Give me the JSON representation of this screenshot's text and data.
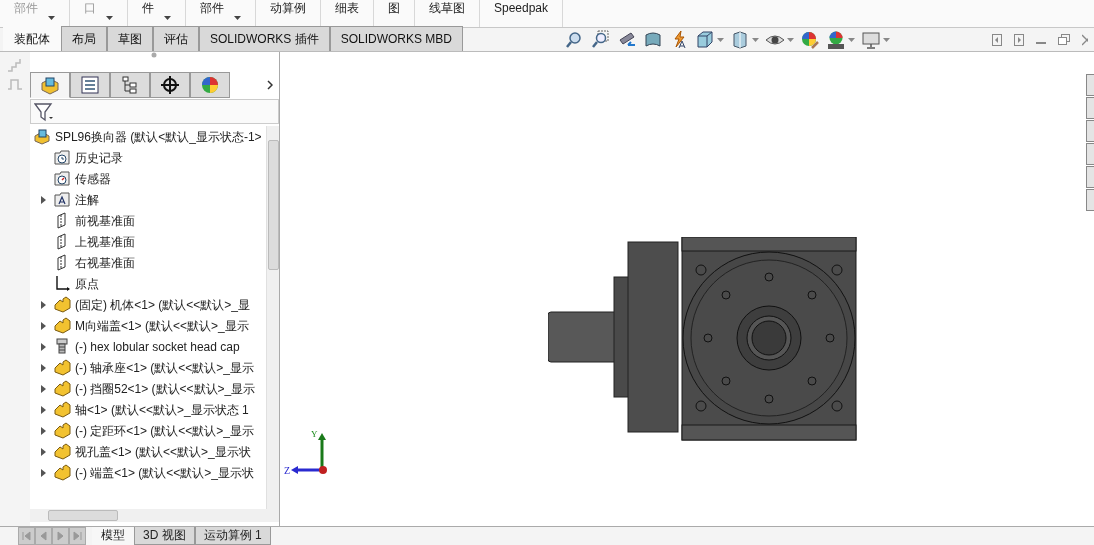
{
  "ribbon": [
    {
      "label": "部件",
      "disabled": true,
      "dropdown": true
    },
    {
      "label": "口",
      "disabled": true,
      "dropdown": true
    },
    {
      "label": "件",
      "disabled": false,
      "dropdown": true
    },
    {
      "label": "部件",
      "disabled": false,
      "dropdown": true
    },
    {
      "label": "动算例",
      "disabled": false,
      "dropdown": false
    },
    {
      "label": "细表",
      "disabled": false,
      "dropdown": false
    },
    {
      "label": "图",
      "disabled": false,
      "dropdown": false
    },
    {
      "label": "线草图",
      "disabled": false,
      "dropdown": false
    },
    {
      "label": "Speedpak",
      "disabled": false,
      "dropdown": false
    }
  ],
  "command_tabs": [
    {
      "label": "装配体",
      "selected": true
    },
    {
      "label": "布局",
      "selected": false
    },
    {
      "label": "草图",
      "selected": false
    },
    {
      "label": "评估",
      "selected": false
    },
    {
      "label": "SOLIDWORKS 插件",
      "selected": false
    },
    {
      "label": "SOLIDWORKS MBD",
      "selected": false
    }
  ],
  "view_toolbar": [
    {
      "kind": "zoom-fit",
      "dropdown": false
    },
    {
      "kind": "zoom-area",
      "dropdown": false
    },
    {
      "kind": "previous",
      "dropdown": false
    },
    {
      "kind": "section",
      "dropdown": false
    },
    {
      "kind": "dynamic",
      "dropdown": false
    },
    {
      "kind": "orientation",
      "dropdown": true
    },
    {
      "kind": "display-style",
      "dropdown": true
    },
    {
      "kind": "hide-show",
      "dropdown": true
    },
    {
      "kind": "appearance",
      "dropdown": false
    },
    {
      "kind": "scene",
      "dropdown": true
    },
    {
      "kind": "monitor",
      "dropdown": true
    }
  ],
  "panel_tabs": [
    {
      "kind": "feature-tree",
      "selected": true
    },
    {
      "kind": "property",
      "selected": false
    },
    {
      "kind": "config",
      "selected": false
    },
    {
      "kind": "dimxpert",
      "selected": false
    },
    {
      "kind": "display",
      "selected": false
    }
  ],
  "tree": [
    {
      "kind": "assembly",
      "label": "SPL96换向器  (默认<默认_显示状态-1>",
      "children": [
        {
          "kind": "history",
          "label": "历史记录",
          "expandable": false
        },
        {
          "kind": "sensor",
          "label": "传感器",
          "expandable": false
        },
        {
          "kind": "annotation",
          "label": "注解",
          "expandable": true
        },
        {
          "kind": "plane",
          "label": "前视基准面",
          "expandable": false
        },
        {
          "kind": "plane",
          "label": "上视基准面",
          "expandable": false
        },
        {
          "kind": "plane",
          "label": "右视基准面",
          "expandable": false
        },
        {
          "kind": "origin",
          "label": "原点",
          "expandable": false
        },
        {
          "kind": "part",
          "label": "(固定) 机体<1> (默认<<默认>_显",
          "expandable": true
        },
        {
          "kind": "part",
          "label": "M向端盖<1> (默认<<默认>_显示",
          "expandable": true
        },
        {
          "kind": "bolt",
          "label": "(-) hex lobular socket head cap",
          "expandable": true
        },
        {
          "kind": "part",
          "label": "(-) 轴承座<1> (默认<<默认>_显示",
          "expandable": true
        },
        {
          "kind": "part",
          "label": "(-) 挡圈52<1> (默认<<默认>_显示",
          "expandable": true
        },
        {
          "kind": "part",
          "label": "轴<1> (默认<<默认>_显示状态 1",
          "expandable": true
        },
        {
          "kind": "part",
          "label": "(-) 定距环<1> (默认<<默认>_显示",
          "expandable": true
        },
        {
          "kind": "part",
          "label": "视孔盖<1> (默认<<默认>_显示状",
          "expandable": true
        },
        {
          "kind": "part",
          "label": "(-) 端盖<1> (默认<<默认>_显示状",
          "expandable": true
        }
      ]
    }
  ],
  "bottom_tabs": [
    {
      "label": "模型",
      "selected": true
    },
    {
      "label": "3D 视图",
      "selected": false
    },
    {
      "label": "运动算例 1",
      "selected": false
    }
  ],
  "triad": {
    "y": "Y",
    "z": "Z"
  }
}
